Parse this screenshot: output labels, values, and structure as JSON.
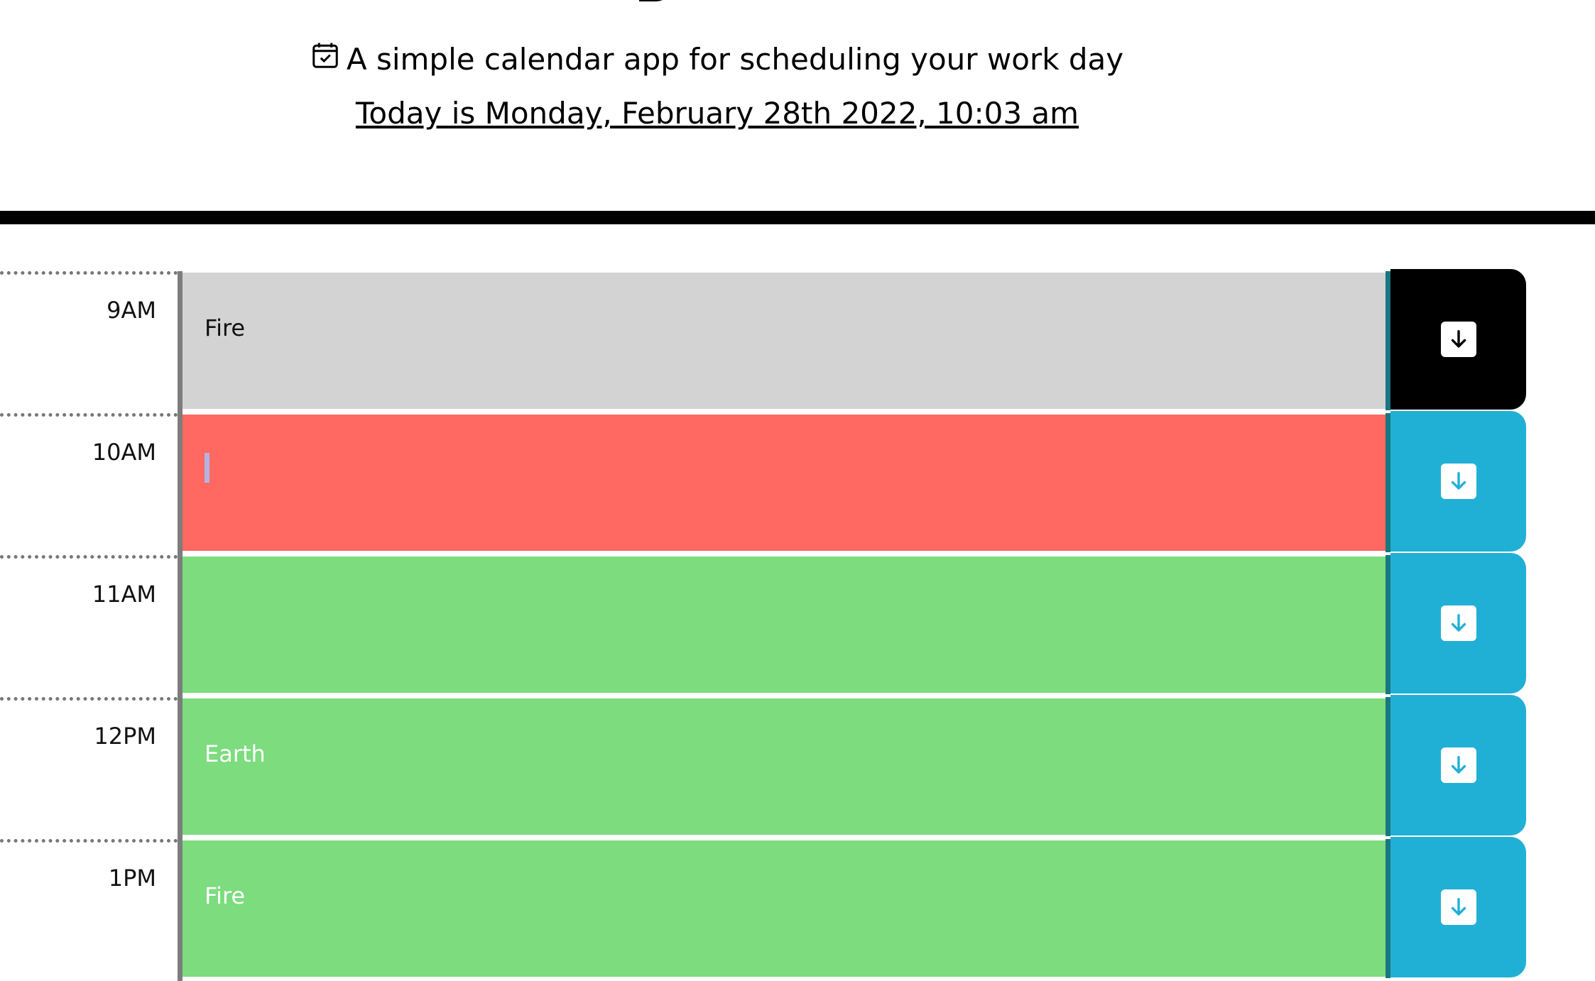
{
  "header": {
    "lead": "A simple calendar app for scheduling your work day",
    "current_day": "Today is Monday, February 28th 2022, 10:03 am",
    "icon": "calendar-check-icon"
  },
  "colors": {
    "past": "#d3d3d3",
    "present": "#ff6961",
    "future": "#7cdc7e",
    "save_button": "#21b0d5",
    "save_button_past": "#000000"
  },
  "timeblocks": [
    {
      "hour": "9AM",
      "text": "Fire",
      "state": "past"
    },
    {
      "hour": "10AM",
      "text": "",
      "state": "present"
    },
    {
      "hour": "11AM",
      "text": "",
      "state": "future"
    },
    {
      "hour": "12PM",
      "text": "Earth",
      "state": "future"
    },
    {
      "hour": "1PM",
      "text": "Fire",
      "state": "future"
    }
  ],
  "save_icon": "save-arrow-down-icon"
}
